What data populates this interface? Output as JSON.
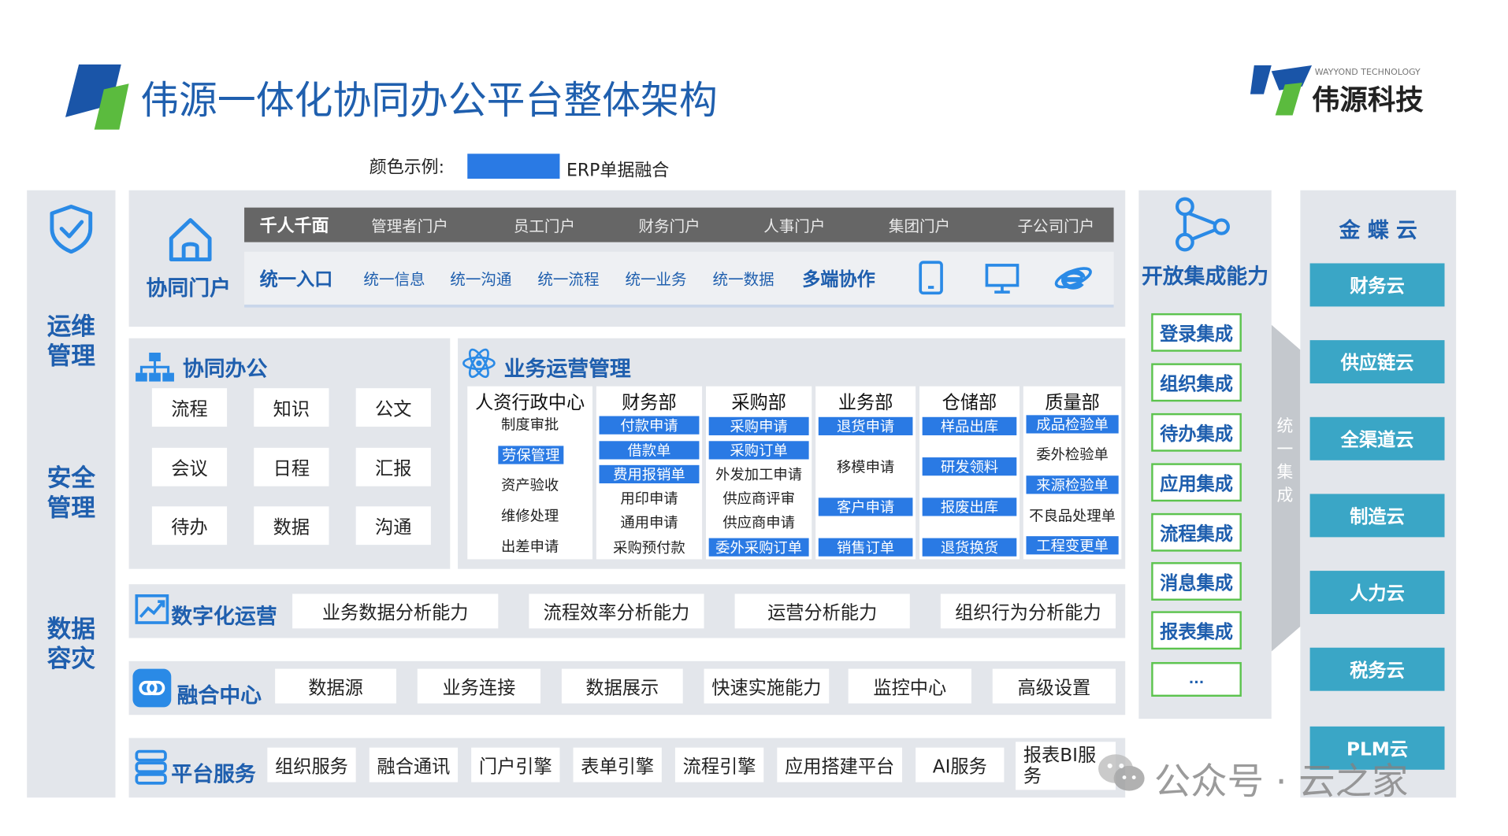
{
  "title": "伟源一体化协同办公平台整体架构",
  "brand": {
    "sub": "WAYYOND TECHNOLOGY",
    "name": "伟源科技"
  },
  "legend": {
    "label": "颜色示例:",
    "text": "ERP单据融合",
    "color": "#2a7ae4"
  },
  "left_column": {
    "items": [
      "运维\n管理",
      "安全\n管理",
      "数据\n容灾"
    ]
  },
  "portal": {
    "title": "协同门户",
    "nav": [
      "千人千面",
      "管理者门户",
      "员工门户",
      "财务门户",
      "人事门户",
      "集团门户",
      "子公司门户"
    ],
    "entry_label": "统一入口",
    "entry_items": [
      "统一信息",
      "统一沟通",
      "统一流程",
      "统一业务",
      "统一数据"
    ],
    "multi_label": "多端协作"
  },
  "collab": {
    "title": "协同办公",
    "items": [
      "流程",
      "知识",
      "公文",
      "会议",
      "日程",
      "汇报",
      "待办",
      "数据",
      "沟通"
    ]
  },
  "biz": {
    "title": "业务运营管理",
    "depts": [
      {
        "name": "人资行政中心",
        "items": [
          {
            "t": "制度审批",
            "h": false
          },
          {
            "t": "劳保管理",
            "h": true
          },
          {
            "t": "资产验收",
            "h": false
          },
          {
            "t": "维修处理",
            "h": false
          },
          {
            "t": "出差申请",
            "h": false
          }
        ]
      },
      {
        "name": "财务部",
        "items": [
          {
            "t": "付款申请",
            "h": true
          },
          {
            "t": "借款单",
            "h": true
          },
          {
            "t": "费用报销单",
            "h": true
          },
          {
            "t": "用印申请",
            "h": false
          },
          {
            "t": "通用申请",
            "h": false
          },
          {
            "t": "采购预付款",
            "h": false
          }
        ]
      },
      {
        "name": "采购部",
        "items": [
          {
            "t": "采购申请",
            "h": true
          },
          {
            "t": "采购订单",
            "h": true
          },
          {
            "t": "外发加工申请",
            "h": false
          },
          {
            "t": "供应商评审",
            "h": false
          },
          {
            "t": "供应商申请",
            "h": false
          },
          {
            "t": "委外采购订单",
            "h": true
          }
        ]
      },
      {
        "name": "业务部",
        "items": [
          {
            "t": "退货申请",
            "h": true
          },
          {
            "t": "移模申请",
            "h": false
          },
          {
            "t": "客户申请",
            "h": true
          },
          {
            "t": "销售订单",
            "h": true
          }
        ]
      },
      {
        "name": "仓储部",
        "items": [
          {
            "t": "样品出库",
            "h": true
          },
          {
            "t": "研发领料",
            "h": true
          },
          {
            "t": "报废出库",
            "h": true
          },
          {
            "t": "退货换货",
            "h": true
          }
        ]
      },
      {
        "name": "质量部",
        "items": [
          {
            "t": "成品检验单",
            "h": true
          },
          {
            "t": "委外检验单",
            "h": false
          },
          {
            "t": "来源检验单",
            "h": true
          },
          {
            "t": "不良品处理单",
            "h": false
          },
          {
            "t": "工程变更单",
            "h": true
          }
        ]
      }
    ]
  },
  "digital": {
    "title": "数字化运营",
    "items": [
      "业务数据分析能力",
      "流程效率分析能力",
      "运营分析能力",
      "组织行为分析能力"
    ]
  },
  "fusion": {
    "title": "融合中心",
    "items": [
      "数据源",
      "业务连接",
      "数据展示",
      "快速实施能力",
      "监控中心",
      "高级设置"
    ]
  },
  "platform": {
    "title": "平台服务",
    "items": [
      "组织服务",
      "融合通讯",
      "门户引擎",
      "表单引擎",
      "流程引擎",
      "应用搭建平台",
      "AI服务",
      "报表BI服务"
    ]
  },
  "open": {
    "title": "开放集成能力",
    "items": [
      "登录集成",
      "组织集成",
      "待办集成",
      "应用集成",
      "流程集成",
      "消息集成",
      "报表集成",
      "..."
    ]
  },
  "arrow_text": "统一集成",
  "kingdee": {
    "title": "金 蝶 云",
    "items": [
      "财务云",
      "供应链云",
      "全渠道云",
      "制造云",
      "人力云",
      "税务云",
      "PLM云"
    ]
  },
  "watermark": "公众号 · 云之家"
}
